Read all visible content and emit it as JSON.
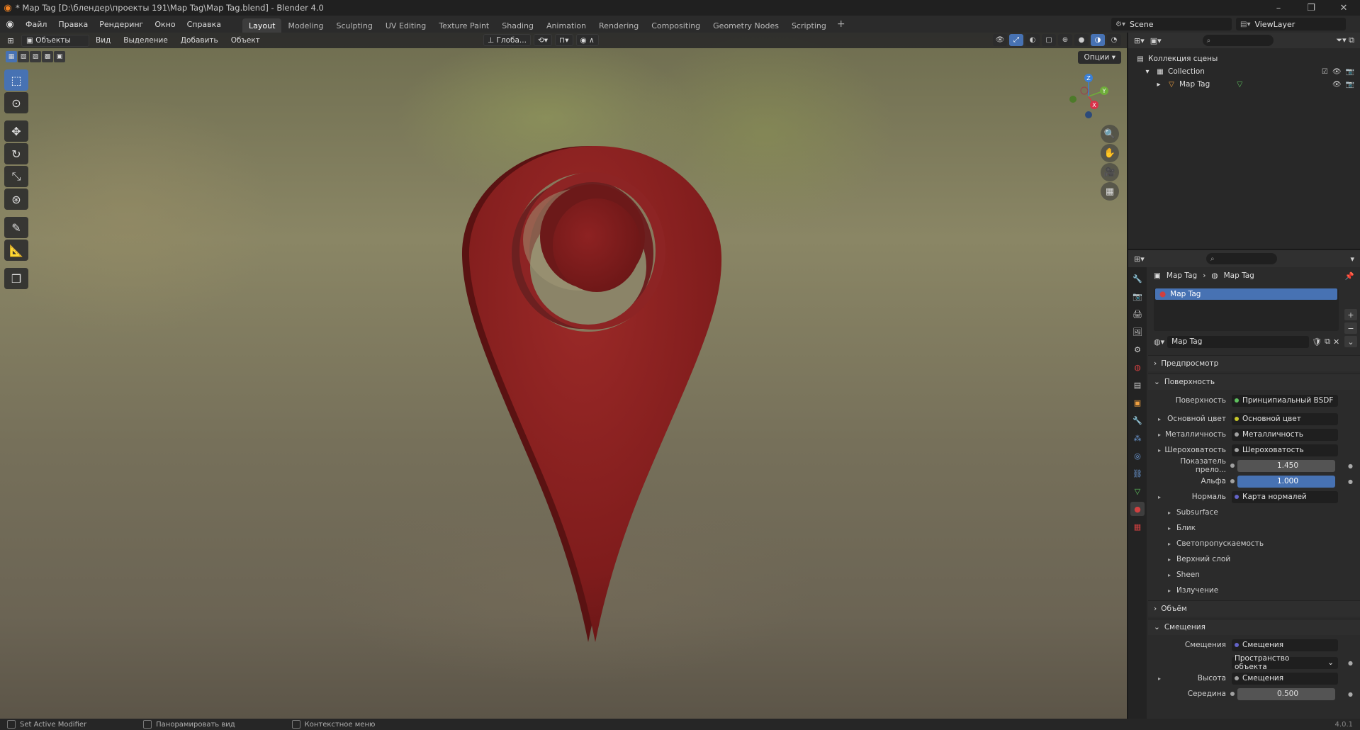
{
  "titlebar": {
    "title": "* Map Tag [D:\\блендер\\проекты 191\\Map Tag\\Map Tag.blend] - Blender 4.0"
  },
  "menu": [
    "Файл",
    "Правка",
    "Рендеринг",
    "Окно",
    "Справка"
  ],
  "workspaces": [
    "Layout",
    "Modeling",
    "Sculpting",
    "UV Editing",
    "Texture Paint",
    "Shading",
    "Animation",
    "Rendering",
    "Compositing",
    "Geometry Nodes",
    "Scripting"
  ],
  "active_workspace": "Layout",
  "scene": "Scene",
  "view_layer": "ViewLayer",
  "viewport": {
    "mode": "Объекты",
    "menus": [
      "Вид",
      "Выделение",
      "Добавить",
      "Объект"
    ],
    "transform_orientation": "Глоба...",
    "options": "Опции"
  },
  "gizmo": {
    "x": "X",
    "y": "Y",
    "z": "Z"
  },
  "outliner": {
    "scene_collection": "Коллекция сцены",
    "collection": "Collection",
    "object": "Map Tag"
  },
  "properties": {
    "crumb_object": "Map Tag",
    "crumb_material": "Map Tag",
    "slot": "Map Tag",
    "material_name": "Map Tag",
    "panels": {
      "preview": "Предпросмотр",
      "surface": "Поверхность",
      "volume": "Объём",
      "displacement": "Смещения"
    },
    "surface": {
      "surface_label": "Поверхность",
      "surface_value": "Принципиальный BSDF",
      "base_color_label": "Основной цвет",
      "base_color_value": "Основной цвет",
      "metallic_label": "Металличность",
      "metallic_value": "Металличность",
      "roughness_label": "Шероховатость",
      "roughness_value": "Шероховатость",
      "ior_label": "Показатель прело...",
      "ior_value": "1.450",
      "alpha_label": "Альфа",
      "alpha_value": "1.000",
      "normal_label": "Нормаль",
      "normal_value": "Карта нормалей"
    },
    "subpanels": [
      "Subsurface",
      "Блик",
      "Светопропускаемость",
      "Верхний слой",
      "Sheen",
      "Излучение"
    ],
    "displacement": {
      "disp_label": "Смещения",
      "disp_value": "Смещения",
      "space_value": "Пространство объекта",
      "height_label": "Высота",
      "height_value": "Смещения",
      "mid_label": "Середина",
      "mid_value": "0.500"
    }
  },
  "status": {
    "left": "Set Active Modifier",
    "middle": "Панорамировать вид",
    "right": "Контекстное меню",
    "version": "4.0.1"
  },
  "colors": {
    "accent": "#4772b3",
    "pin": "#8a1f1f"
  }
}
